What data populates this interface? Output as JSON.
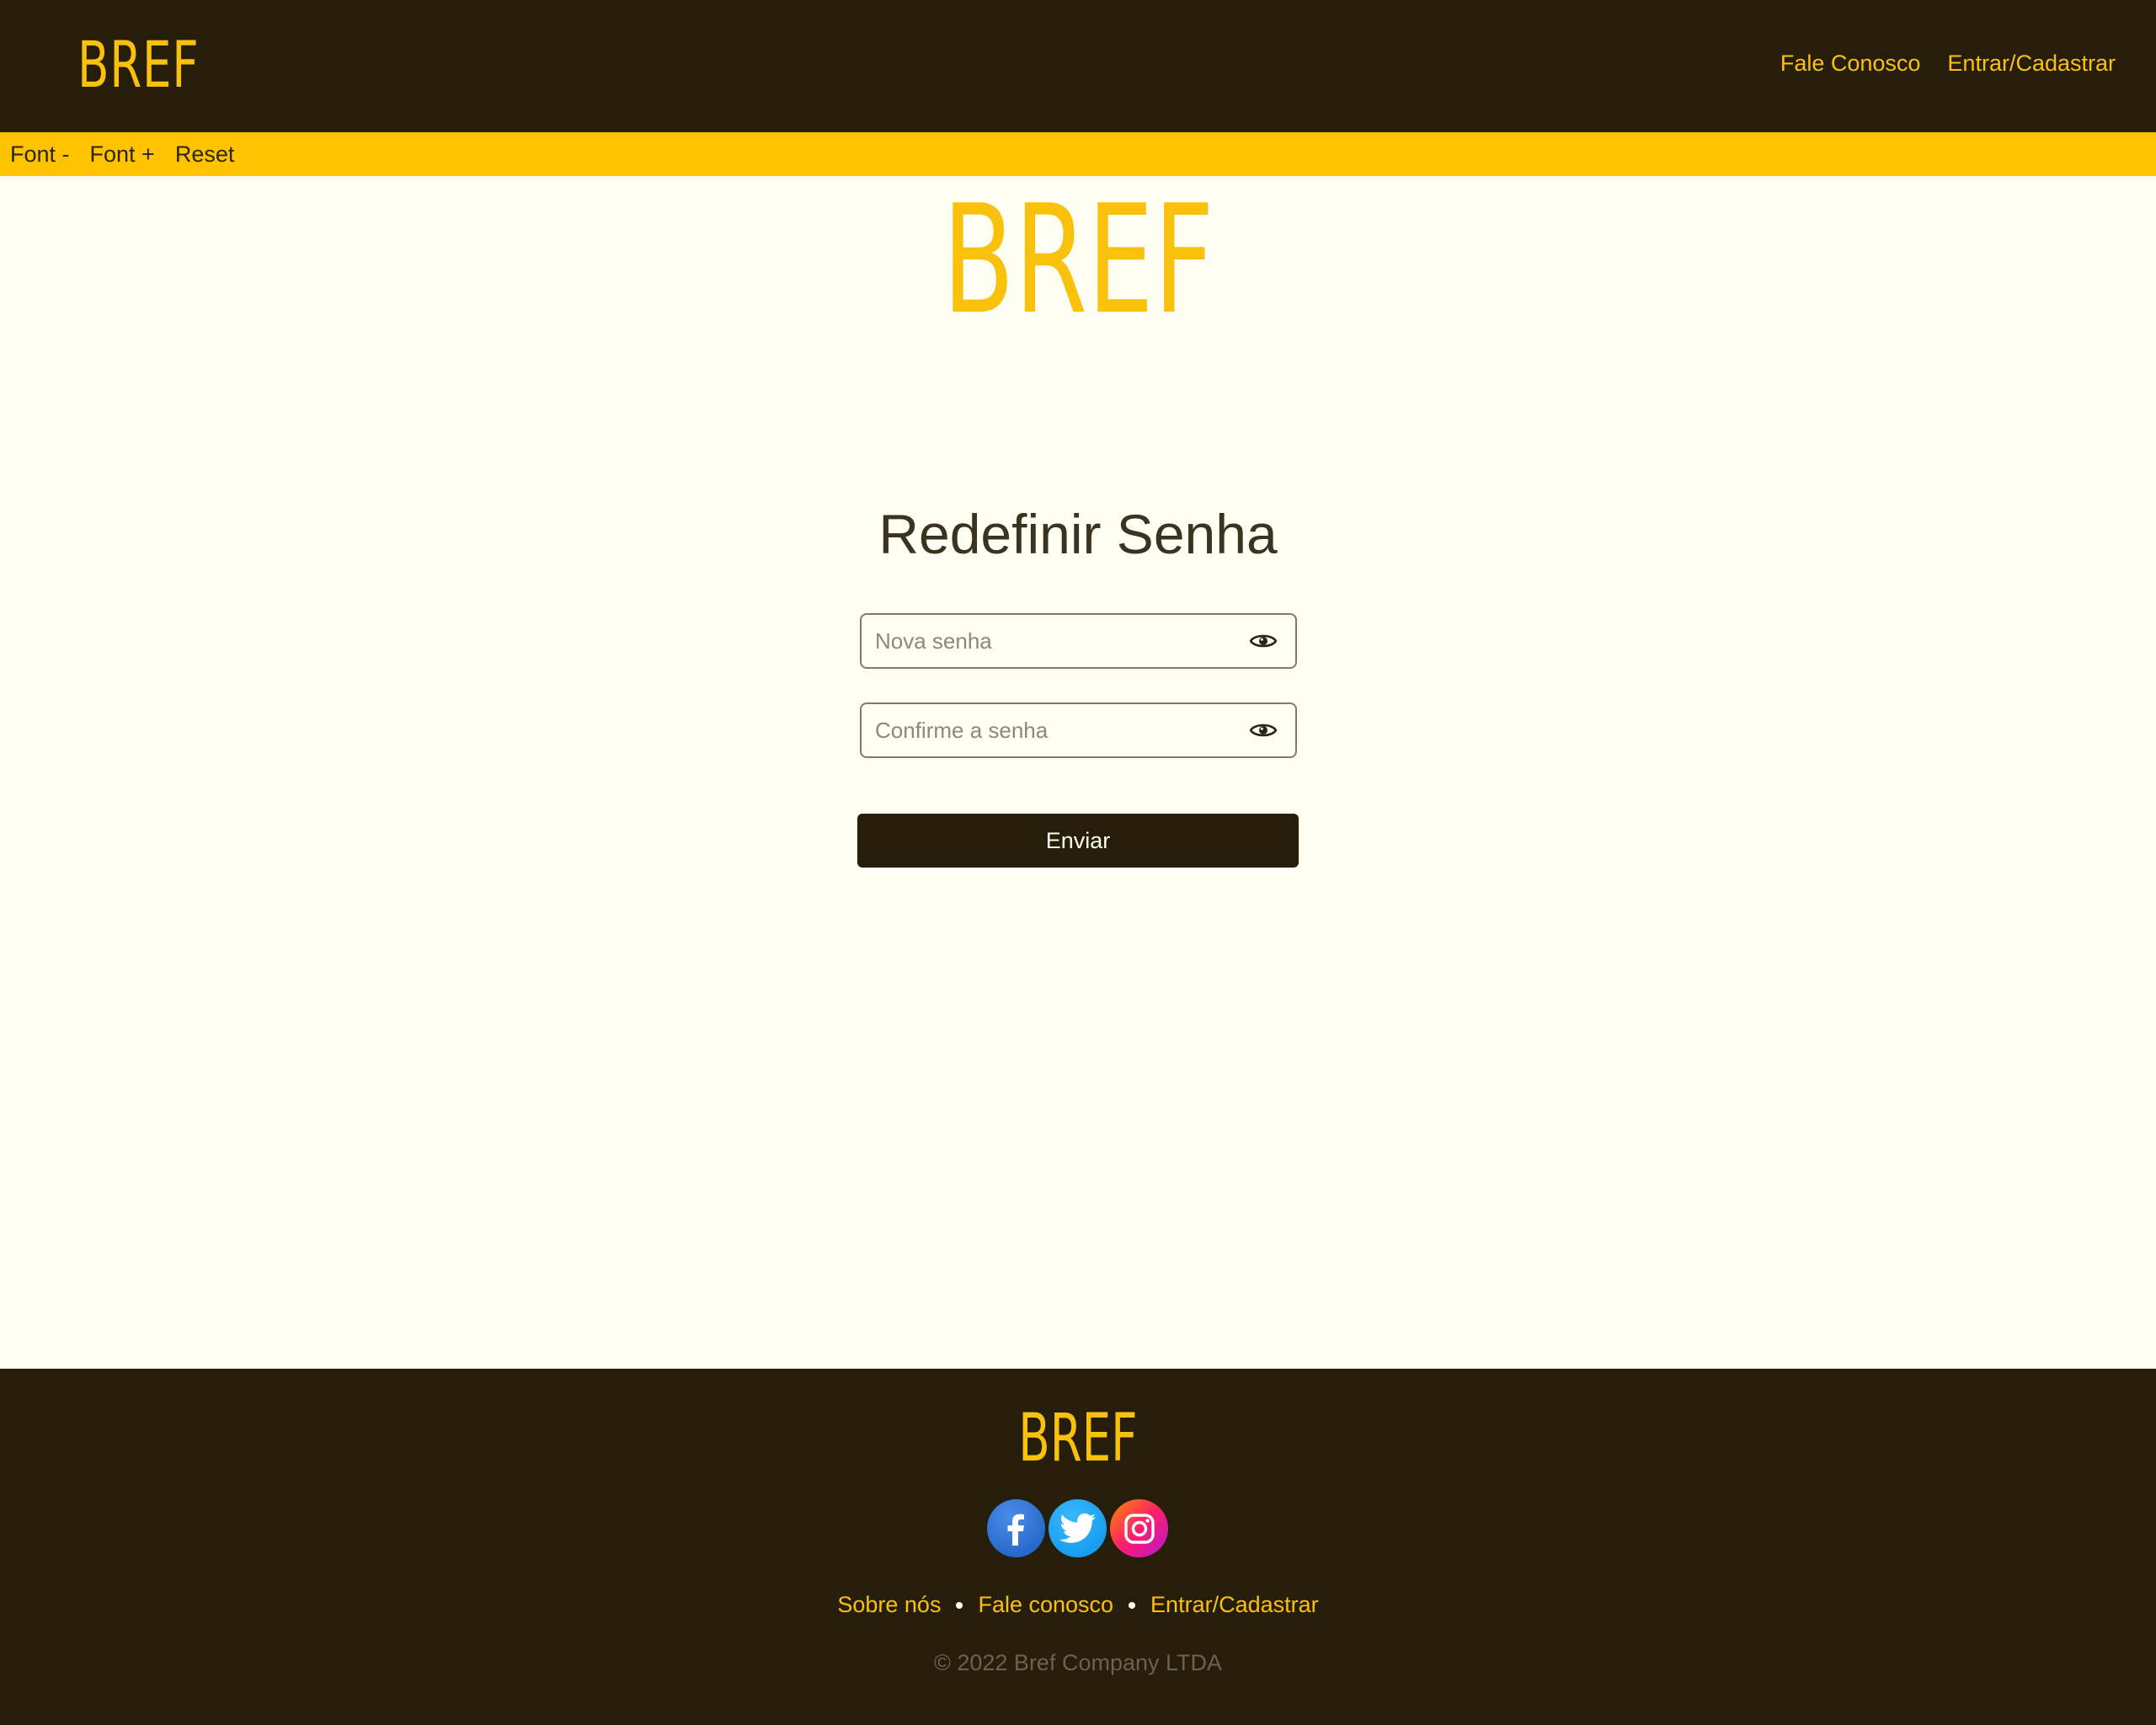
{
  "header": {
    "logo": "BREF",
    "nav": {
      "contact": "Fale Conosco",
      "login": "Entrar/Cadastrar"
    }
  },
  "accessibility": {
    "font_decrease": "Font -",
    "font_increase": "Font +",
    "reset": "Reset"
  },
  "main": {
    "logo": "BREF",
    "title": "Redefinir Senha",
    "new_password_placeholder": "Nova senha",
    "confirm_password_placeholder": "Confirme a senha",
    "submit_label": "Enviar"
  },
  "footer": {
    "logo": "BREF",
    "social": [
      "facebook-icon",
      "twitter-icon",
      "instagram-icon"
    ],
    "links": {
      "about": "Sobre nós",
      "contact": "Fale conosco",
      "login": "Entrar/Cadastrar"
    },
    "copyright": "© 2022 Bref Company LTDA"
  },
  "colors": {
    "dark": "#261E0A",
    "accent": "#F9C10B",
    "bar": "#FFC300",
    "background": "#FFFEF2"
  }
}
